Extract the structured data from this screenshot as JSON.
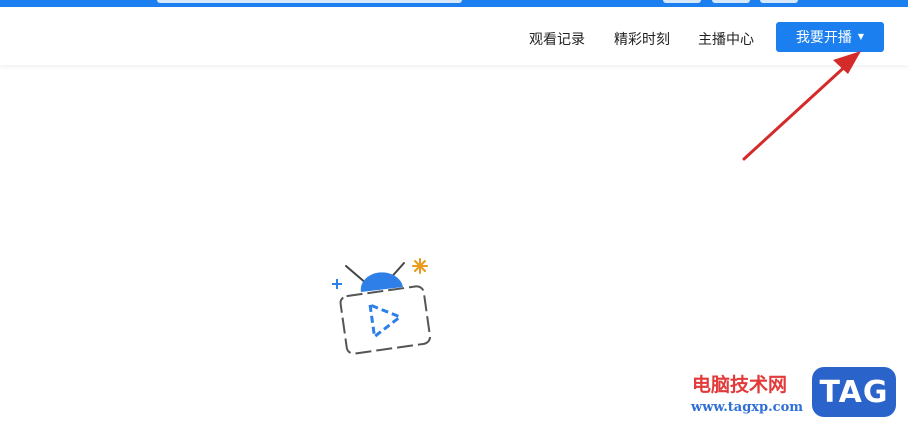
{
  "colors": {
    "accent": "#1b7ff0",
    "annotation_arrow": "#d42a2a",
    "watermark_red": "#e23a3a",
    "watermark_blue": "#2a63c9"
  },
  "header": {
    "nav": [
      {
        "label": "观看记录"
      },
      {
        "label": "精彩时刻"
      },
      {
        "label": "主播中心"
      }
    ],
    "go_live": {
      "label": "我要开播",
      "icon": "caret-down-icon"
    }
  },
  "main": {
    "empty_state_icon": "tv-play-icon"
  },
  "watermark": {
    "text": "电脑技术网",
    "url": "www.tagxp.com",
    "logo": "TAG"
  }
}
